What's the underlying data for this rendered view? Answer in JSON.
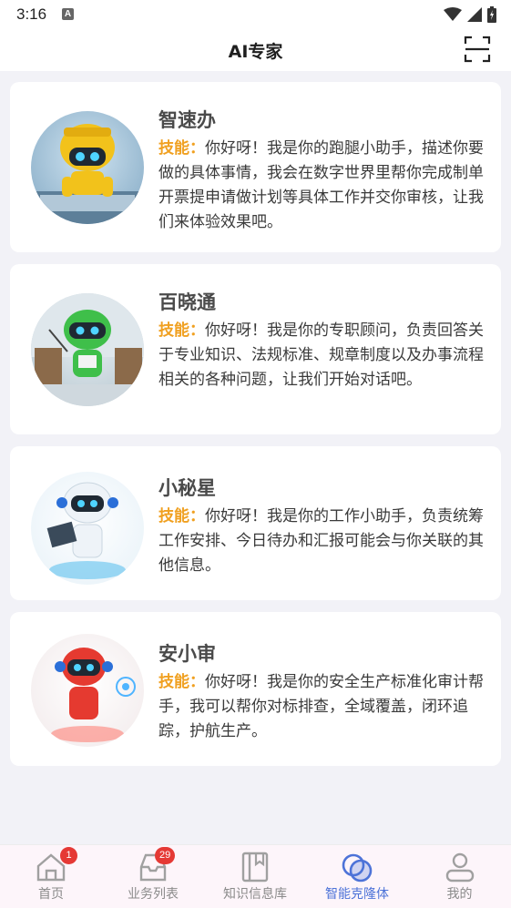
{
  "status_bar": {
    "time": "3:16",
    "notification_letter": "A"
  },
  "header": {
    "title": "AI专家"
  },
  "skill_label": "技能：",
  "experts": [
    {
      "name": "智速办",
      "desc": "你好呀！我是你的跑腿小助手，描述你要做的具体事情，我会在数字世界里帮你完成制单开票提申请做计划等具体工作并交你审核，让我们来体验效果吧。",
      "robot_color": "#f2c21b"
    },
    {
      "name": "百晓通",
      "desc": "你好呀！我是你的专职顾问，负责回答关于专业知识、法规标准、规章制度以及办事流程相关的各种问题，让我们开始对话吧。",
      "robot_color": "#3fbf4a"
    },
    {
      "name": "小秘星",
      "desc": "你好呀！我是你的工作小助手，负责统筹工作安排、今日待办和汇报可能会与你关联的其他信息。",
      "robot_color": "#eef3f8"
    },
    {
      "name": "安小审",
      "desc": "你好呀！我是你的安全生产标准化审计帮手，我可以帮你对标排查，全域覆盖，闭环追踪，护航生产。",
      "robot_color": "#e53a30"
    }
  ],
  "tabs": [
    {
      "label": "首页",
      "badge": "1",
      "icon": "home-icon"
    },
    {
      "label": "业务列表",
      "badge": "29",
      "icon": "inbox-icon"
    },
    {
      "label": "知识信息库",
      "badge": "",
      "icon": "book-icon"
    },
    {
      "label": "智能克隆体",
      "badge": "",
      "icon": "clone-icon",
      "active": true
    },
    {
      "label": "我的",
      "badge": "",
      "icon": "user-icon"
    }
  ],
  "colors": {
    "accent": "#4d73d8",
    "skill": "#f0a020",
    "badge": "#e53935"
  }
}
